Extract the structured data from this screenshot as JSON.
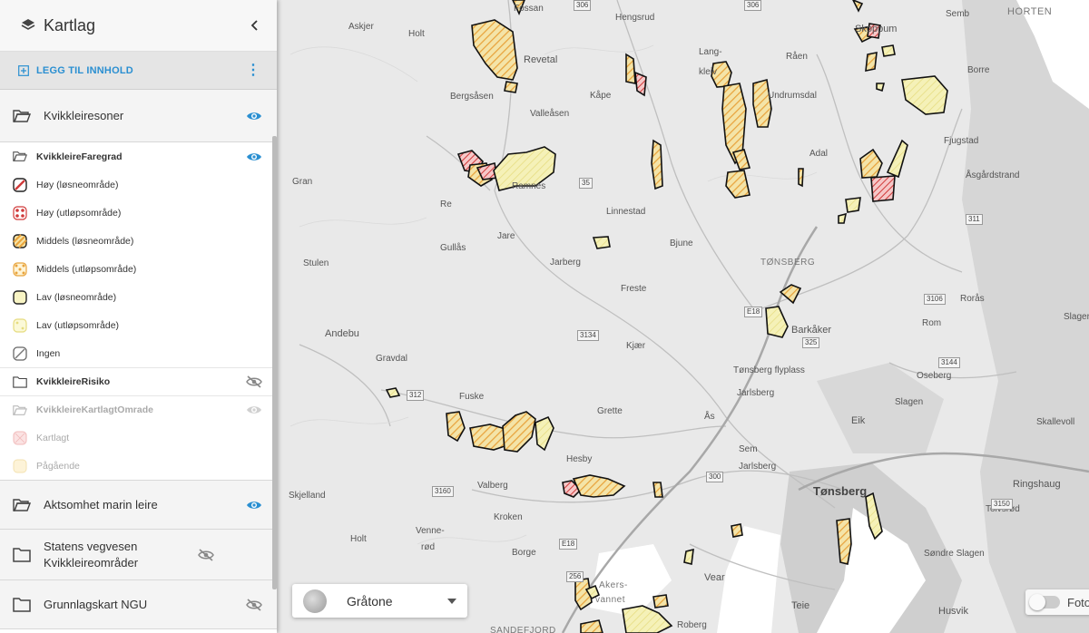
{
  "panel": {
    "title": "Kartlag",
    "add_content": "LEGG TIL INNHOLD",
    "groups": [
      {
        "label": "Kvikkleiresoner"
      },
      {
        "label": "Aktsomhet marin leire"
      },
      {
        "label": "Statens vegvesen Kvikkleireområder"
      },
      {
        "label": "Grunnlagskart NGU"
      }
    ],
    "faregrad": {
      "label": "KvikkleireFaregrad",
      "items": [
        {
          "label": "Høy (løsneområde)",
          "color": "#c0392b"
        },
        {
          "label": "Høy (utløpsområde)",
          "color": "#c0392b"
        },
        {
          "label": "Middels (løsneområde)",
          "color": "#e8a33c"
        },
        {
          "label": "Middels (utløpsområde)",
          "color": "#e8a33c"
        },
        {
          "label": "Lav (løsneområde)",
          "color": "#f2e97a"
        },
        {
          "label": "Lav (utløpsområde)",
          "color": "#f2e97a"
        },
        {
          "label": "Ingen",
          "color": "#888888"
        }
      ]
    },
    "risiko": {
      "label": "KvikkleireRisiko"
    },
    "kartlagt": {
      "label": "KvikkleireKartlagtOmrade",
      "items": [
        {
          "label": "Kartlagt"
        },
        {
          "label": "Pågående"
        }
      ]
    }
  },
  "basemap": {
    "label": "Gråtone"
  },
  "photo_toggle": {
    "label": "Foto"
  },
  "places": {
    "fossan": "Fossan",
    "hengsrud": "Hengsrud",
    "semb": "Semb",
    "horten": "HORTEN",
    "askjer": "Askjer",
    "holt1": "Holt",
    "revetal": "Revetal",
    "lang": "Lang-",
    "kleiv": "kleiv",
    "raen": "Råen",
    "skoppum": "Skoppum",
    "borre": "Borre",
    "bergsasen": "Bergsåsen",
    "valleasen": "Valleåsen",
    "kape": "Kåpe",
    "undrumsdal": "Undrumsdal",
    "fjugstad": "Fjugstad",
    "adal": "Adal",
    "asgardstrand": "Åsgårdstrand",
    "gran": "Gran",
    "re": "Re",
    "ramnes": "Ramnes",
    "linnestad": "Linnestad",
    "jare": "Jare",
    "bjune": "Bjune",
    "gullas": "Gullås",
    "stulen": "Stulen",
    "jarberg": "Jarberg",
    "tonsberg_label": "TØNSBERG",
    "freste": "Freste",
    "rorås": "Rorås",
    "slagen1": "Slagen",
    "andebu": "Andebu",
    "barkaker": "Barkåker",
    "rom": "Rom",
    "kjaer": "Kjær",
    "gravdal": "Gravdal",
    "tonsberg_flyplass": "Tønsberg flyplass",
    "oseberg": "Oseberg",
    "fuske": "Fuske",
    "jarlsberg1": "Jarlsberg",
    "slagen2": "Slagen",
    "grette": "Grette",
    "as": "Ås",
    "eik": "Eik",
    "skallevoll": "Skallevoll",
    "sem": "Sem",
    "hesby": "Hesby",
    "jarlsberg2": "Jarlsberg",
    "ringshaug": "Ringshaug",
    "valberg": "Valberg",
    "tonsberg": "Tønsberg",
    "skjelland": "Skjelland",
    "kroken": "Kroken",
    "tolvsrød": "Tolvsrød",
    "venne": "Venne-",
    "rod": "rød",
    "holt2": "Holt",
    "borge": "Borge",
    "sondre_slagen": "Søndre Slagen",
    "akersvannet": "Akers-",
    "vannet": "vannet",
    "vear": "Vear",
    "teie": "Teie",
    "husvik": "Husvik",
    "roberg": "Roberg",
    "slager": "Slager",
    "sandefjord": "SANDEFJORD"
  },
  "roads": {
    "r306a": "306",
    "r306b": "306",
    "r35": "35",
    "r3134": "3134",
    "r312": "312",
    "e18a": "E18",
    "r325": "325",
    "r3106": "3106",
    "r3144": "3144",
    "r311": "311",
    "r300": "300",
    "r3150": "3150",
    "r3160": "3160",
    "r256": "256",
    "e18b": "E18"
  }
}
